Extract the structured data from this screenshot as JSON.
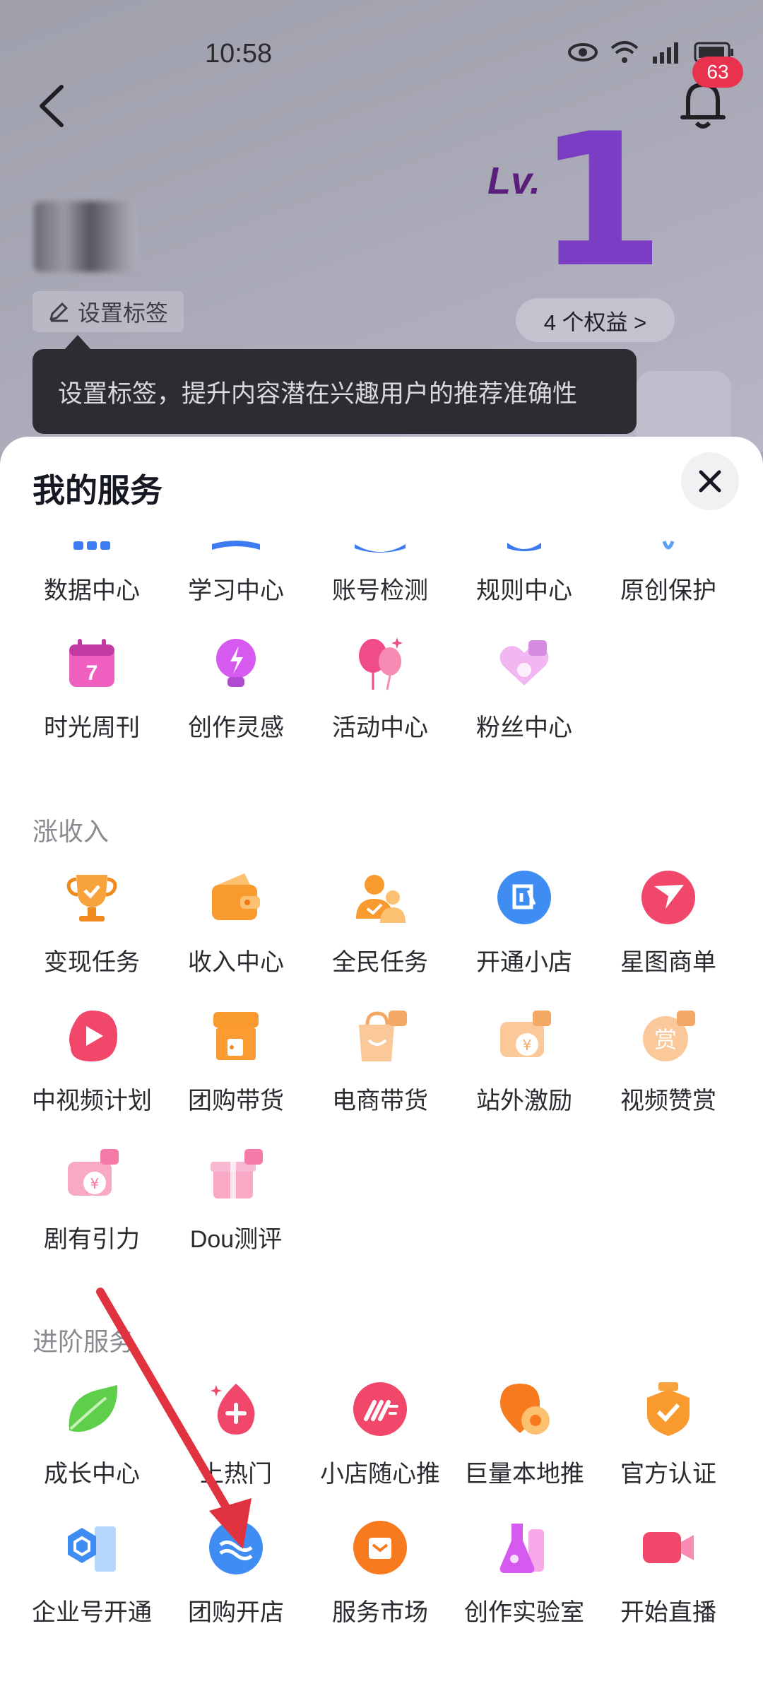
{
  "status_bar": {
    "time": "10:58"
  },
  "header": {
    "notification_count": "63"
  },
  "profile": {
    "tag_button": "设置标签",
    "level_prefix": "Lv.",
    "level_number": "1",
    "rights_button": "4 个权益 >",
    "tooltip": "设置标签，提升内容潜在兴趣用户的推荐准确性"
  },
  "sheet": {
    "title": "我的服务",
    "top_items": [
      "数据中心",
      "学习中心",
      "账号检测",
      "规则中心",
      "原创保护"
    ],
    "row2_items": [
      "时光周刊",
      "创作灵感",
      "活动中心",
      "粉丝中心"
    ],
    "income": {
      "label": "涨收入",
      "items": [
        "变现任务",
        "收入中心",
        "全民任务",
        "开通小店",
        "星图商单",
        "中视频计划",
        "团购带货",
        "电商带货",
        "站外激励",
        "视频赞赏",
        "剧有引力",
        "Dou测评"
      ]
    },
    "advanced": {
      "label": "进阶服务",
      "items": [
        "成长中心",
        "上热门",
        "小店随心推",
        "巨量本地推",
        "官方认证",
        "企业号开通",
        "团购开店",
        "服务市场",
        "创作实验室",
        "开始直播"
      ]
    }
  },
  "icons": {
    "back": "back-arrow-icon",
    "bell": "bell-icon",
    "pencil": "pencil-icon",
    "close": "close-icon"
  },
  "colors": {
    "accent_red": "#e8324e",
    "tooltip_bg": "#2c2c32",
    "annotation_arrow": "#e0333f"
  }
}
